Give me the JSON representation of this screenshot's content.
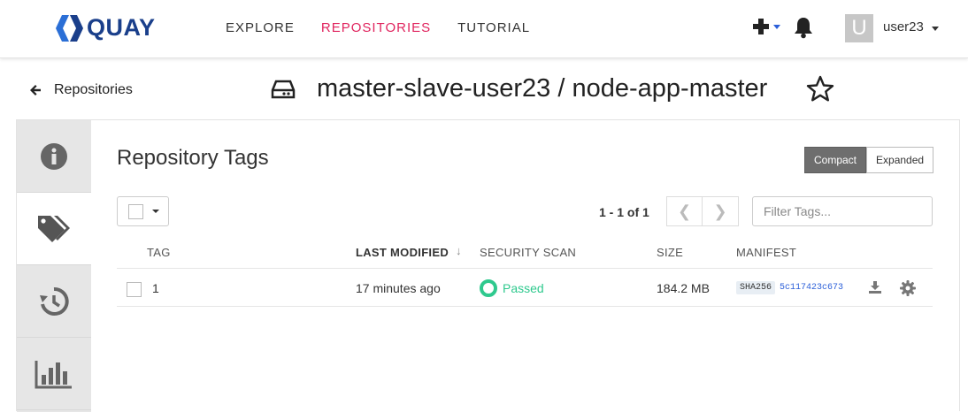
{
  "header": {
    "logo_text": "QUAY",
    "nav": [
      {
        "label": "EXPLORE"
      },
      {
        "label": "REPOSITORIES"
      },
      {
        "label": "TUTORIAL"
      }
    ],
    "user": {
      "avatar_letter": "U",
      "name": "user23"
    }
  },
  "subheader": {
    "back_label": "Repositories",
    "repo_title": "master-slave-user23 / node-app-master"
  },
  "side_tabs": [
    {
      "icon": "info-icon"
    },
    {
      "icon": "tags-icon"
    },
    {
      "icon": "history-icon"
    },
    {
      "icon": "usage-logs-icon"
    }
  ],
  "tags_panel": {
    "title": "Repository Tags",
    "view_toggle": {
      "compact": "Compact",
      "expanded": "Expanded"
    },
    "pager_text": "1 - 1 of 1",
    "pager_prev": "❮",
    "pager_next": "❯",
    "filter_placeholder": "Filter Tags...",
    "columns": {
      "tag": "TAG",
      "last_modified": "LAST MODIFIED",
      "security_scan": "SECURITY SCAN",
      "size": "SIZE",
      "manifest": "MANIFEST"
    },
    "rows": [
      {
        "tag": "1",
        "last_modified": "17 minutes ago",
        "security_scan": "Passed",
        "size": "184.2 MB",
        "digest_algo": "SHA256",
        "digest_hash": "5c117423c673"
      }
    ]
  },
  "colors": {
    "accent_pink": "#e0245e",
    "logo_blue": "#1a3f8b",
    "passed_green": "#2fc98e",
    "link_blue": "#2b5fd9"
  }
}
